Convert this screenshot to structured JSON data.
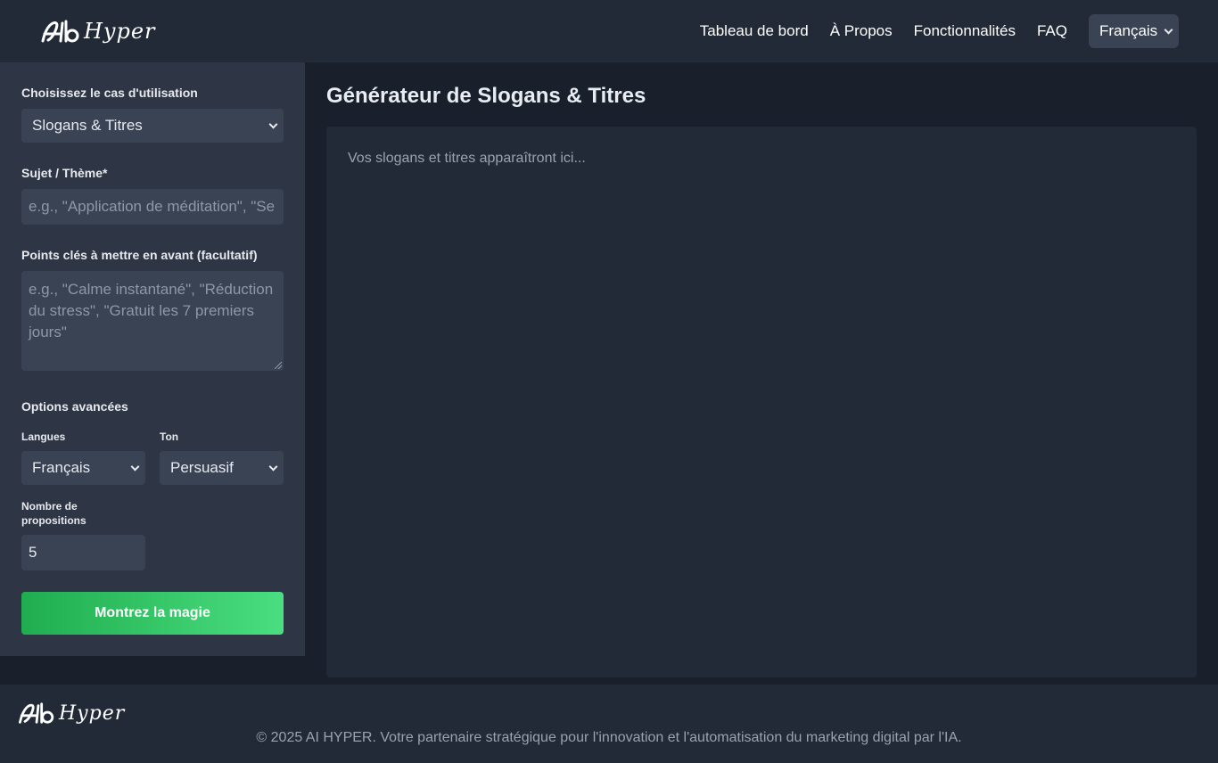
{
  "brand": {
    "logo_text": "Hyper",
    "logo_icon": "ai-monogram-icon"
  },
  "nav": {
    "items": [
      "Tableau de bord",
      "À Propos",
      "Fonctionnalités",
      "FAQ"
    ],
    "language": "Français"
  },
  "form": {
    "use_case_label": "Choisissez le cas d'utilisation",
    "use_case_value": "Slogans & Titres",
    "subject_label": "Sujet / Thème*",
    "subject_placeholder": "e.g., \"Application de méditation\", \"Se",
    "keypoints_label": "Points clés à mettre en avant (facultatif)",
    "keypoints_placeholder": "e.g., \"Calme instantané\", \"Réduction du stress\", \"Gratuit les 7 premiers jours\"",
    "advanced_label": "Options avancées",
    "languages_label": "Langues",
    "languages_value": "Français",
    "tone_label": "Ton",
    "tone_value": "Persuasif",
    "count_label": "Nombre de propositions",
    "count_value": "5",
    "submit_label": "Montrez la magie"
  },
  "main": {
    "title": "Générateur de Slogans & Titres",
    "output_placeholder": "Vos slogans et titres apparaîtront ici..."
  },
  "footer": {
    "logo_text": "Hyper",
    "copyright": "© 2025 AI HYPER. Votre partenaire stratégique pour l'innovation et l'automatisation du marketing digital par l'IA."
  },
  "colors": {
    "accent_start": "#1fad4f",
    "accent_end": "#4ade80",
    "header_bg": "#222a38",
    "sidebar_bg": "#2e3545",
    "field_bg": "#3a4354"
  }
}
